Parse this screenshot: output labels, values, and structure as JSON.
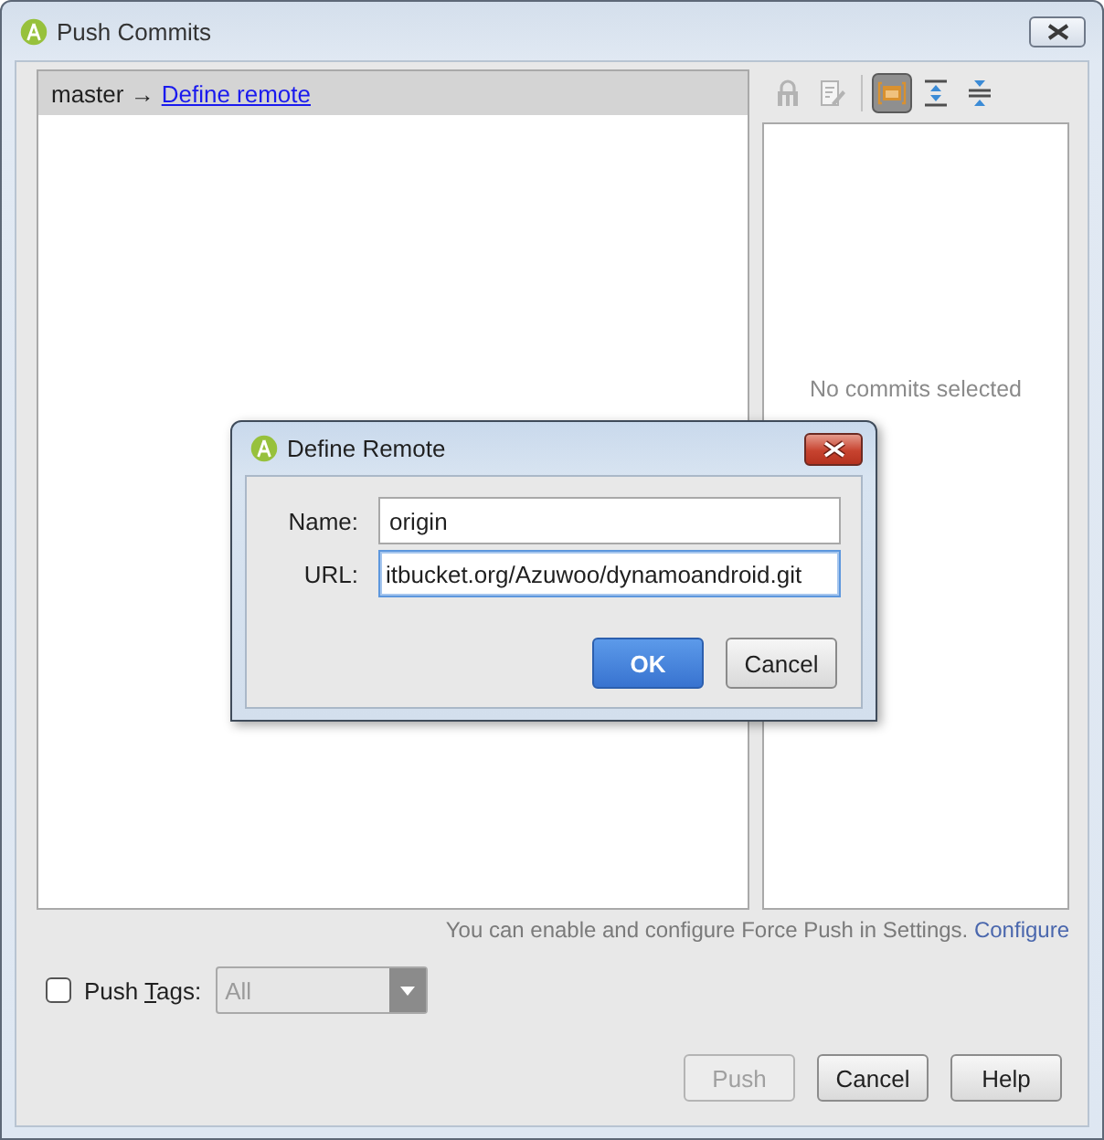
{
  "window": {
    "title": "Push Commits"
  },
  "branch_header": {
    "label": "master →",
    "link": "Define remote"
  },
  "toolbar": [
    {
      "selected": false,
      "disabled": true
    },
    {
      "selected": false,
      "disabled": true
    },
    {
      "selected": true,
      "disabled": false
    },
    {
      "selected": false,
      "disabled": false
    },
    {
      "selected": false,
      "disabled": false
    }
  ],
  "details": {
    "empty_text": "No commits selected"
  },
  "hint": {
    "text": "You can enable and configure Force Push in Settings.",
    "link": "Configure"
  },
  "push_tags": {
    "checked": false,
    "label": {
      "before": "Push ",
      "mnemonic": "T",
      "after": "ags:"
    },
    "dropdown": {
      "value": "All",
      "disabled": true
    }
  },
  "buttons": [
    {
      "label": "Push",
      "disabled": true
    },
    {
      "label": "Cancel",
      "disabled": false
    },
    {
      "label": "Help",
      "disabled": false
    }
  ],
  "dialog": {
    "title": "Define Remote",
    "fields": [
      {
        "label": "Name:",
        "value": "origin",
        "focused": false
      },
      {
        "label": "URL:",
        "value": "itbucket.org/Azuwoo/dynamoandroid.git",
        "focused": true
      }
    ],
    "buttons": [
      {
        "label": "OK",
        "default": true
      },
      {
        "label": "Cancel",
        "default": false
      }
    ]
  }
}
